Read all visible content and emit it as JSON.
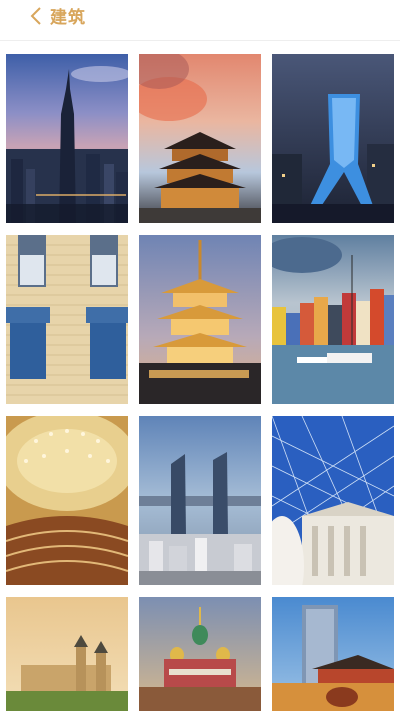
{
  "header": {
    "back_icon": "chevron-left-icon",
    "title": "建筑",
    "accent_color": "#d8a65c"
  },
  "gallery": {
    "tiles": [
      {
        "subject": "skyscraper-city-dusk"
      },
      {
        "subject": "chinese-pavilion-sunset"
      },
      {
        "subject": "modern-tower-night"
      },
      {
        "subject": "building-facade-windows"
      },
      {
        "subject": "pagoda-evening"
      },
      {
        "subject": "colorful-harbor-houses"
      },
      {
        "subject": "concert-hall-interior"
      },
      {
        "subject": "twin-towers-coast"
      },
      {
        "subject": "glass-dome-museum"
      },
      {
        "subject": "palace-hilltop"
      },
      {
        "subject": "onion-dome-cathedral"
      },
      {
        "subject": "tower-and-gate"
      }
    ]
  }
}
